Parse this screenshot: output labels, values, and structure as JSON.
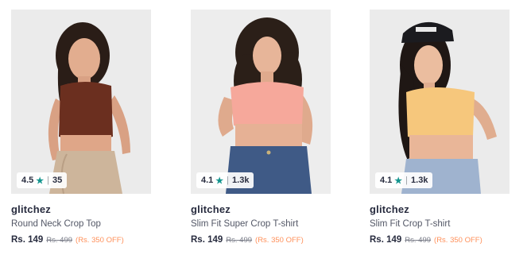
{
  "products": [
    {
      "brand": "glitchez",
      "name": "Round Neck Crop Top",
      "price": "Rs. 149",
      "mrp": "Rs. 499",
      "discount": "(Rs. 350 OFF)",
      "rating": "4.5",
      "rating_count": "35",
      "image": "woman-brown-sleeveless-crop-top"
    },
    {
      "brand": "glitchez",
      "name": "Slim Fit Super Crop T-shirt",
      "price": "Rs. 149",
      "mrp": "Rs. 499",
      "discount": "(Rs. 350 OFF)",
      "rating": "4.1",
      "rating_count": "1.3k",
      "image": "woman-pink-crop-tshirt"
    },
    {
      "brand": "glitchez",
      "name": "Slim Fit Crop T-shirt",
      "price": "Rs. 149",
      "mrp": "Rs. 499",
      "discount": "(Rs. 350 OFF)",
      "rating": "4.1",
      "rating_count": "1.3k",
      "image": "woman-yellow-crop-tshirt"
    }
  ],
  "colors": {
    "rating_star": "#14958f",
    "discount": "#ff905a",
    "text_primary": "#282c3f",
    "text_secondary": "#535766",
    "mrp": "#7e818c"
  },
  "icons": {
    "rating": "star-icon"
  }
}
